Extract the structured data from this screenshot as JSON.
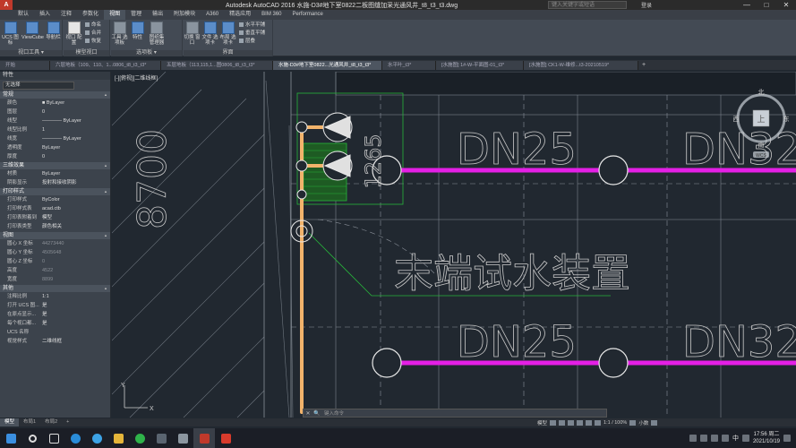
{
  "titlebar": {
    "title": "Autodesk AutoCAD 2016   水施-D3#地下室0822二板图缝加采光通风井_t8_t3_t3.dwg",
    "search_placeholder": "键入关键字或短语",
    "login": "登录",
    "minimize": "—",
    "maximize": "□",
    "close": "✕"
  },
  "ribbon_tabs": [
    "默认",
    "插入",
    "注释",
    "参数化",
    "视图",
    "管理",
    "输出",
    "附加模块",
    "A360",
    "精选应用",
    "BIM 360",
    "Performance"
  ],
  "ribbon": {
    "groups": [
      "视口工具 ▾",
      "模型视口",
      "选项板 ▾",
      "界面"
    ],
    "buttons": {
      "ucs_icon": "UCS 图标",
      "viewcube": "ViewCube",
      "nav_bar": "导航栏",
      "viewport_config": "视口 配置",
      "tool_palettes": "工具 选项板",
      "properties": "特性",
      "sheet_set": "图纸集 管理器",
      "switch_windows": "切换 窗口",
      "file_tabs": "文件 选项卡",
      "layout_tabs": "布局 选项卡"
    },
    "small": {
      "named": "命名",
      "join": "合并",
      "restore": "恢复",
      "tile_h": "水平平铺",
      "tile_v": "垂直平铺",
      "cascade": "层叠"
    }
  },
  "doc_tabs": [
    "开始",
    "六层地板（109、110、1...0806_t8_t3_t3*",
    "五层地板（113,115,1...图0806_t8_t3_t3*",
    "水施-D3#地下室0822...光通风井_t8_t3_t3*",
    "水平叶_t3*",
    "[水施图] 1#-W-平面图-01_t3*",
    "[水施图] CK1-W-维修...t3-20210519*"
  ],
  "properties": {
    "title": "特性",
    "selection": "无选择",
    "side_title": "特性",
    "sections": [
      {
        "name": "常规",
        "rows": [
          {
            "k": "颜色",
            "v": "■ ByLayer"
          },
          {
            "k": "图层",
            "v": "0"
          },
          {
            "k": "线型",
            "v": "———— ByLayer"
          },
          {
            "k": "线型比例",
            "v": "1"
          },
          {
            "k": "线宽",
            "v": "———— ByLayer"
          },
          {
            "k": "透明度",
            "v": "ByLayer"
          },
          {
            "k": "厚度",
            "v": "0"
          }
        ]
      },
      {
        "name": "三维效果",
        "rows": [
          {
            "k": "材质",
            "v": "ByLayer"
          },
          {
            "k": "阴影显示",
            "v": "投射和接收阴影"
          }
        ]
      },
      {
        "name": "打印样式",
        "rows": [
          {
            "k": "打印样式",
            "v": "ByColor"
          },
          {
            "k": "打印样式表",
            "v": "acad.ctb"
          },
          {
            "k": "打印表附着到",
            "v": "模型"
          },
          {
            "k": "打印表类型",
            "v": "颜色相关"
          }
        ]
      },
      {
        "name": "视图",
        "rows": [
          {
            "k": "圆心 X 坐标",
            "v": "44273440"
          },
          {
            "k": "圆心 Y 坐标",
            "v": "4505648"
          },
          {
            "k": "圆心 Z 坐标",
            "v": "0"
          },
          {
            "k": "高度",
            "v": "4522"
          },
          {
            "k": "宽度",
            "v": "8899"
          }
        ]
      },
      {
        "name": "其他",
        "rows": [
          {
            "k": "注释比例",
            "v": "1:1"
          },
          {
            "k": "打开 UCS 图...",
            "v": "是"
          },
          {
            "k": "在原点显示...",
            "v": "是"
          },
          {
            "k": "每个视口都...",
            "v": "是"
          },
          {
            "k": "UCS 名称",
            "v": ""
          },
          {
            "k": "视觉样式",
            "v": "二维线框"
          }
        ]
      }
    ]
  },
  "canvas": {
    "view_label": "[-][俯视][二维线框]",
    "dim_text": "8700",
    "dim_small": "1265",
    "pipe_labels": [
      "DN25",
      "DN32",
      "DN25",
      "DN32"
    ],
    "device_label": "末端试水装置",
    "ucs_y": "Y",
    "ucs_x": "X"
  },
  "navcube": {
    "north": "北",
    "south": "南",
    "east": "东",
    "west": "西",
    "top": "上",
    "wcs": "WCS"
  },
  "cmdline": {
    "placeholder": "键入命令",
    "close": "✕",
    "search": "🔍"
  },
  "layout_tabs": [
    "模型",
    "布局1",
    "布局2",
    "+"
  ],
  "status": {
    "mode": "模型",
    "scale": "1:1 / 100%",
    "decimal": "小数"
  },
  "taskbar": {
    "clock_time": "17:56 周二",
    "clock_date": "2021/10/19",
    "ime": "中"
  },
  "colors": {
    "pipe_magenta": "#e41fe5",
    "pipe_orange": "#f2b36b",
    "green": "#27b33a",
    "bg": "#212830"
  }
}
